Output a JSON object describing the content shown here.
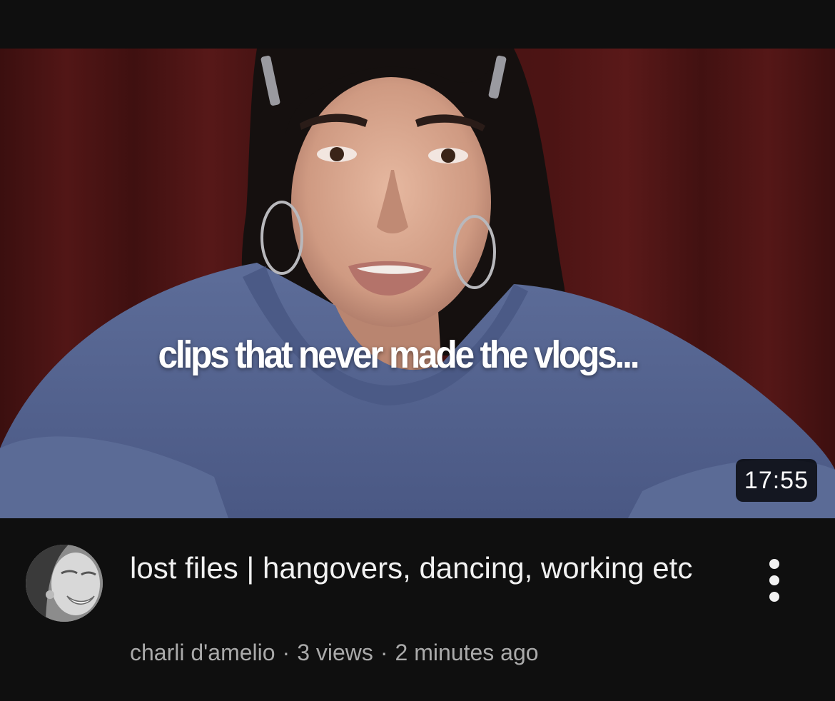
{
  "video": {
    "thumbnail_overlay_text": "clips that never made the vlogs...",
    "duration": "17:55",
    "title": "lost files | hangovers, dancing, working etc",
    "channel_name": "charli d'amelio",
    "views": "3 views",
    "age": "2 minutes ago",
    "meta_separator": "·"
  },
  "icons": {
    "more_actions": "more-vert-icon",
    "channel_avatar": "channel-avatar"
  },
  "colors": {
    "background": "#0f0f0f",
    "title_text": "#f1f1f1",
    "meta_text": "#aaaaaa",
    "thumbnail_backdrop": "#4a1414",
    "hoodie": "#55658f",
    "badge_background": "#000000"
  }
}
